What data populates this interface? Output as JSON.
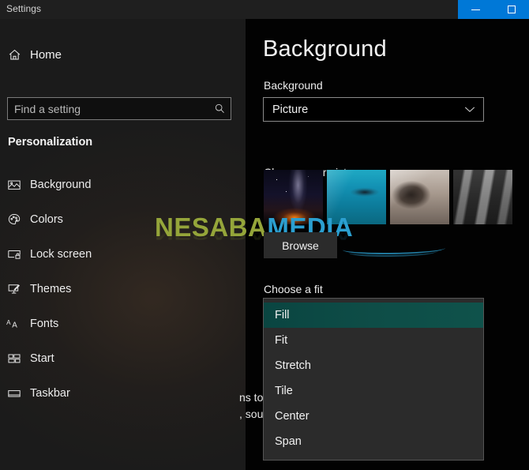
{
  "window": {
    "title": "Settings",
    "caption_buttons": [
      {
        "name": "minimize",
        "glyph": "minimize-icon"
      },
      {
        "name": "maximize",
        "glyph": "maximize-icon"
      }
    ],
    "accent_color": "#0078d7"
  },
  "sidebar": {
    "home_label": "Home",
    "home_icon": "home-icon",
    "search": {
      "placeholder": "Find a setting",
      "value": "",
      "icon": "search-icon"
    },
    "section_title": "Personalization",
    "items": [
      {
        "label": "Background",
        "icon": "picture-icon"
      },
      {
        "label": "Colors",
        "icon": "palette-icon"
      },
      {
        "label": "Lock screen",
        "icon": "lock-screen-icon"
      },
      {
        "label": "Themes",
        "icon": "themes-brush-icon"
      },
      {
        "label": "Fonts",
        "icon": "fonts-aa-icon"
      },
      {
        "label": "Start",
        "icon": "start-tiles-icon"
      },
      {
        "label": "Taskbar",
        "icon": "taskbar-icon"
      }
    ]
  },
  "main": {
    "page_title": "Background",
    "background_section": {
      "label": "Background",
      "selected_value": "Picture",
      "chevron": "chevron-down-icon"
    },
    "choose_picture": {
      "label": "Choose your picture",
      "thumbnails": [
        {
          "name": "thumbnail-night-sky"
        },
        {
          "name": "thumbnail-underwater-diver"
        },
        {
          "name": "thumbnail-desk-tablet-pen"
        },
        {
          "name": "thumbnail-rock-texture"
        }
      ],
      "browse_label": "Browse"
    },
    "choose_fit": {
      "label": "Choose a fit",
      "options": [
        {
          "label": "Fill",
          "selected": true
        },
        {
          "label": "Fit",
          "selected": false
        },
        {
          "label": "Stretch",
          "selected": false
        },
        {
          "label": "Tile",
          "selected": false
        },
        {
          "label": "Center",
          "selected": false
        },
        {
          "label": "Span",
          "selected": false
        }
      ],
      "highlight_color": "#0e4d47"
    },
    "obscured_text": {
      "line1": "ns to see",
      "line2": ", sounds"
    }
  },
  "watermark": {
    "text_part_1": "NESABA",
    "text_part_2": "MEDIA",
    "color_1": "#95a53a",
    "color_2": "#2b9fd0"
  }
}
